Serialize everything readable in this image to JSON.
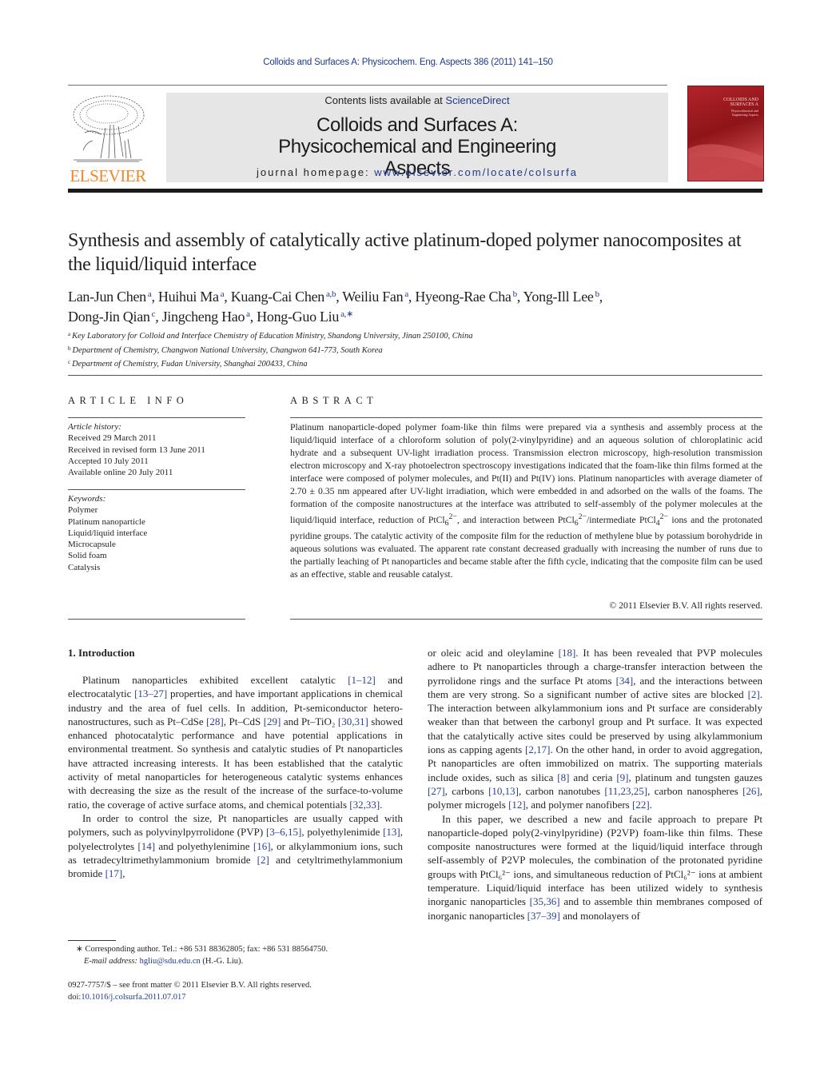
{
  "header": {
    "journal_reference": "Colloids and Surfaces A: Physicochem. Eng. Aspects 386 (2011) 141–150",
    "contents_prefix": "Contents lists available at ",
    "contents_link": "ScienceDirect",
    "journal_title": "Colloids and Surfaces A: Physicochemical and Engineering Aspects",
    "homepage_prefix": "journal homepage: ",
    "homepage_link": "www.elsevier.com/locate/colsurfa",
    "publisher_logo": "ELSEVIER",
    "cover": {
      "title_line1": "COLLOIDS AND",
      "title_line2": "SURFACES A",
      "subtitle": "Physicochemical and Engineering Aspects",
      "color": "#a3161c"
    },
    "logo_color": "#f2872a"
  },
  "article": {
    "title": "Synthesis and assembly of catalytically active platinum-doped polymer nanocomposites at the liquid/liquid interface",
    "authors": [
      {
        "name": "Lan-Jun Chen",
        "aff": "a"
      },
      {
        "name": "Huihui Ma",
        "aff": "a"
      },
      {
        "name": "Kuang-Cai Chen",
        "aff": "a,b"
      },
      {
        "name": "Weiliu Fan",
        "aff": "a"
      },
      {
        "name": "Hyeong-Rae Cha",
        "aff": "b"
      },
      {
        "name": "Yong-Ill Lee",
        "aff": "b"
      },
      {
        "name": "Dong-Jin Qian",
        "aff": "c"
      },
      {
        "name": "Jingcheng Hao",
        "aff": "a"
      },
      {
        "name": "Hong-Guo Liu",
        "aff": "a,∗"
      }
    ],
    "affiliations": [
      {
        "key": "a",
        "text": "Key Laboratory for Colloid and Interface Chemistry of Education Ministry, Shandong University, Jinan 250100, China"
      },
      {
        "key": "b",
        "text": "Department of Chemistry, Changwon National University, Changwon 641-773, South Korea"
      },
      {
        "key": "c",
        "text": "Department of Chemistry, Fudan University, Shanghai 200433, China"
      }
    ]
  },
  "article_info": {
    "heading": "ARTICLE INFO",
    "history_label": "Article history:",
    "history": [
      "Received 29 March 2011",
      "Received in revised form 13 June 2011",
      "Accepted 10 July 2011",
      "Available online 20 July 2011"
    ],
    "keywords_label": "Keywords:",
    "keywords": [
      "Polymer",
      "Platinum nanoparticle",
      "Liquid/liquid interface",
      "Microcapsule",
      "Solid foam",
      "Catalysis"
    ]
  },
  "abstract": {
    "heading": "ABSTRACT",
    "text_1": "Platinum nanoparticle-doped polymer foam-like thin films were prepared via a synthesis and assembly process at the liquid/liquid interface of a chloroform solution of poly(2-vinylpyridine) and an aqueous solution of chloroplatinic acid hydrate and a subsequent UV-light irradiation process. Transmission electron microscopy, high-resolution transmission electron microscopy and X-ray photoelectron spectroscopy investigations indicated that the foam-like thin films formed at the interface were composed of polymer molecules, and Pt(II) and Pt(IV) ions. Platinum nanoparticles with average diameter of 2.70 ± 0.35 nm appeared after UV-light irradiation, which were embedded in and adsorbed on the walls of the foams. The formation of the composite nanostructures at the interface was attributed to self-assembly of the polymer molecules at the liquid/liquid interface, reduction of PtCl",
    "text_2": ", and interaction between PtCl",
    "text_3": "/intermediate PtCl",
    "text_4": " ions and the protonated pyridine groups. The catalytic activity of the composite film for the reduction of methylene blue by potassium borohydride in aqueous solutions was evaluated. The apparent rate constant decreased gradually with increasing the number of runs due to the partially leaching of Pt nanoparticles and became stable after the fifth cycle, indicating that the composite film can be used as an effective, stable and reusable catalyst.",
    "sub6": "6",
    "sub4": "4",
    "charge": "2−",
    "copyright": "© 2011 Elsevier B.V. All rights reserved."
  },
  "introduction": {
    "heading": "1.  Introduction",
    "p1": [
      {
        "t": "Platinum nanoparticles exhibited excellent catalytic "
      },
      {
        "c": "[1–12]"
      },
      {
        "t": " and electrocatalytic "
      },
      {
        "c": "[13–27]"
      },
      {
        "t": " properties, and have important applications in chemical industry and the area of fuel cells. In addition, Pt-semiconductor hetero-nanostructures, such as Pt–CdSe "
      },
      {
        "c": "[28]"
      },
      {
        "t": ", Pt–CdS "
      },
      {
        "c": "[29]"
      },
      {
        "t": " and Pt–TiO₂ "
      },
      {
        "c": "[30,31]"
      },
      {
        "t": " showed enhanced photocatalytic performance and have potential applications in environmental treatment. So synthesis and catalytic studies of Pt nanoparticles have attracted increasing interests. It has been established that the catalytic activity of metal nanoparticles for heterogeneous catalytic systems enhances with decreasing the size as the result of the increase of the surface-to-volume ratio, the coverage of active surface atoms, and chemical potentials "
      },
      {
        "c": "[32,33]"
      },
      {
        "t": "."
      }
    ],
    "p2": [
      {
        "t": "In order to control the size, Pt nanoparticles are usually capped with polymers, such as polyvinylpyrrolidone (PVP) "
      },
      {
        "c": "[3–6,15]"
      },
      {
        "t": ", polyethylenimide "
      },
      {
        "c": "[13]"
      },
      {
        "t": ", polyelectrolytes "
      },
      {
        "c": "[14]"
      },
      {
        "t": " and polyethylenimine "
      },
      {
        "c": "[16]"
      },
      {
        "t": ", or alkylammonium ions, such as tetradecyltrimethylammonium bromide "
      },
      {
        "c": "[2]"
      },
      {
        "t": " and cetyltrimethylammonium bromide "
      },
      {
        "c": "[17]"
      },
      {
        "t": ","
      }
    ],
    "p2_cont": [
      {
        "t": "or oleic acid and oleylamine "
      },
      {
        "c": "[18]"
      },
      {
        "t": ". It has been revealed that PVP molecules adhere to Pt nanoparticles through a charge-transfer interaction between the pyrrolidone rings and the surface Pt atoms "
      },
      {
        "c": "[34]"
      },
      {
        "t": ", and the interactions between them are very strong. So a significant number of active sites are blocked "
      },
      {
        "c": "[2]"
      },
      {
        "t": ". The interaction between alkylammonium ions and Pt surface are considerably weaker than that between the carbonyl group and Pt surface. It was expected that the catalytically active sites could be preserved by using alkylammonium ions as capping agents "
      },
      {
        "c": "[2,17]"
      },
      {
        "t": ". On the other hand, in order to avoid aggregation, Pt nanoparticles are often immobilized on matrix. The supporting materials include oxides, such as silica "
      },
      {
        "c": "[8]"
      },
      {
        "t": " and ceria "
      },
      {
        "c": "[9]"
      },
      {
        "t": ", platinum and tungsten gauzes "
      },
      {
        "c": "[27]"
      },
      {
        "t": ", carbons "
      },
      {
        "c": "[10,13]"
      },
      {
        "t": ", carbon nanotubes "
      },
      {
        "c": "[11,23,25]"
      },
      {
        "t": ", carbon nanospheres "
      },
      {
        "c": "[26]"
      },
      {
        "t": ", polymer microgels "
      },
      {
        "c": "[12]"
      },
      {
        "t": ", and polymer nanofibers "
      },
      {
        "c": "[22]"
      },
      {
        "t": "."
      }
    ],
    "p3": [
      {
        "t": "In this paper, we described a new and facile approach to prepare Pt nanoparticle-doped poly(2-vinylpyridine) (P2VP) foam-like thin films. These composite nanostructures were formed at the liquid/liquid interface through self-assembly of P2VP molecules, the combination of the protonated pyridine groups with PtCl₆²⁻ ions, and simultaneous reduction of PtCl₆²⁻ ions at ambient temperature. Liquid/liquid interface has been utilized widely to synthesis inorganic nanoparticles "
      },
      {
        "c": "[35,36]"
      },
      {
        "t": " and to assemble thin membranes composed of inorganic nanoparticles "
      },
      {
        "c": "[37–39]"
      },
      {
        "t": " and monolayers of"
      }
    ]
  },
  "footnote": {
    "star": "∗",
    "corresponding": "Corresponding author. Tel.: +86 531 88362805; fax: +86 531 88564750.",
    "email_label": "E-mail address:",
    "email": "hgliu@sdu.edu.cn",
    "email_suffix": " (H.-G. Liu)."
  },
  "front_matter": {
    "issn_line": "0927-7757/$ – see front matter © 2011 Elsevier B.V. All rights reserved.",
    "doi_prefix": "doi:",
    "doi": "10.1016/j.colsurfa.2011.07.017"
  },
  "colors": {
    "link": "#1f3a8a",
    "banner_bg": "#e6e6e6",
    "rule_dark": "#1a1a1a"
  }
}
